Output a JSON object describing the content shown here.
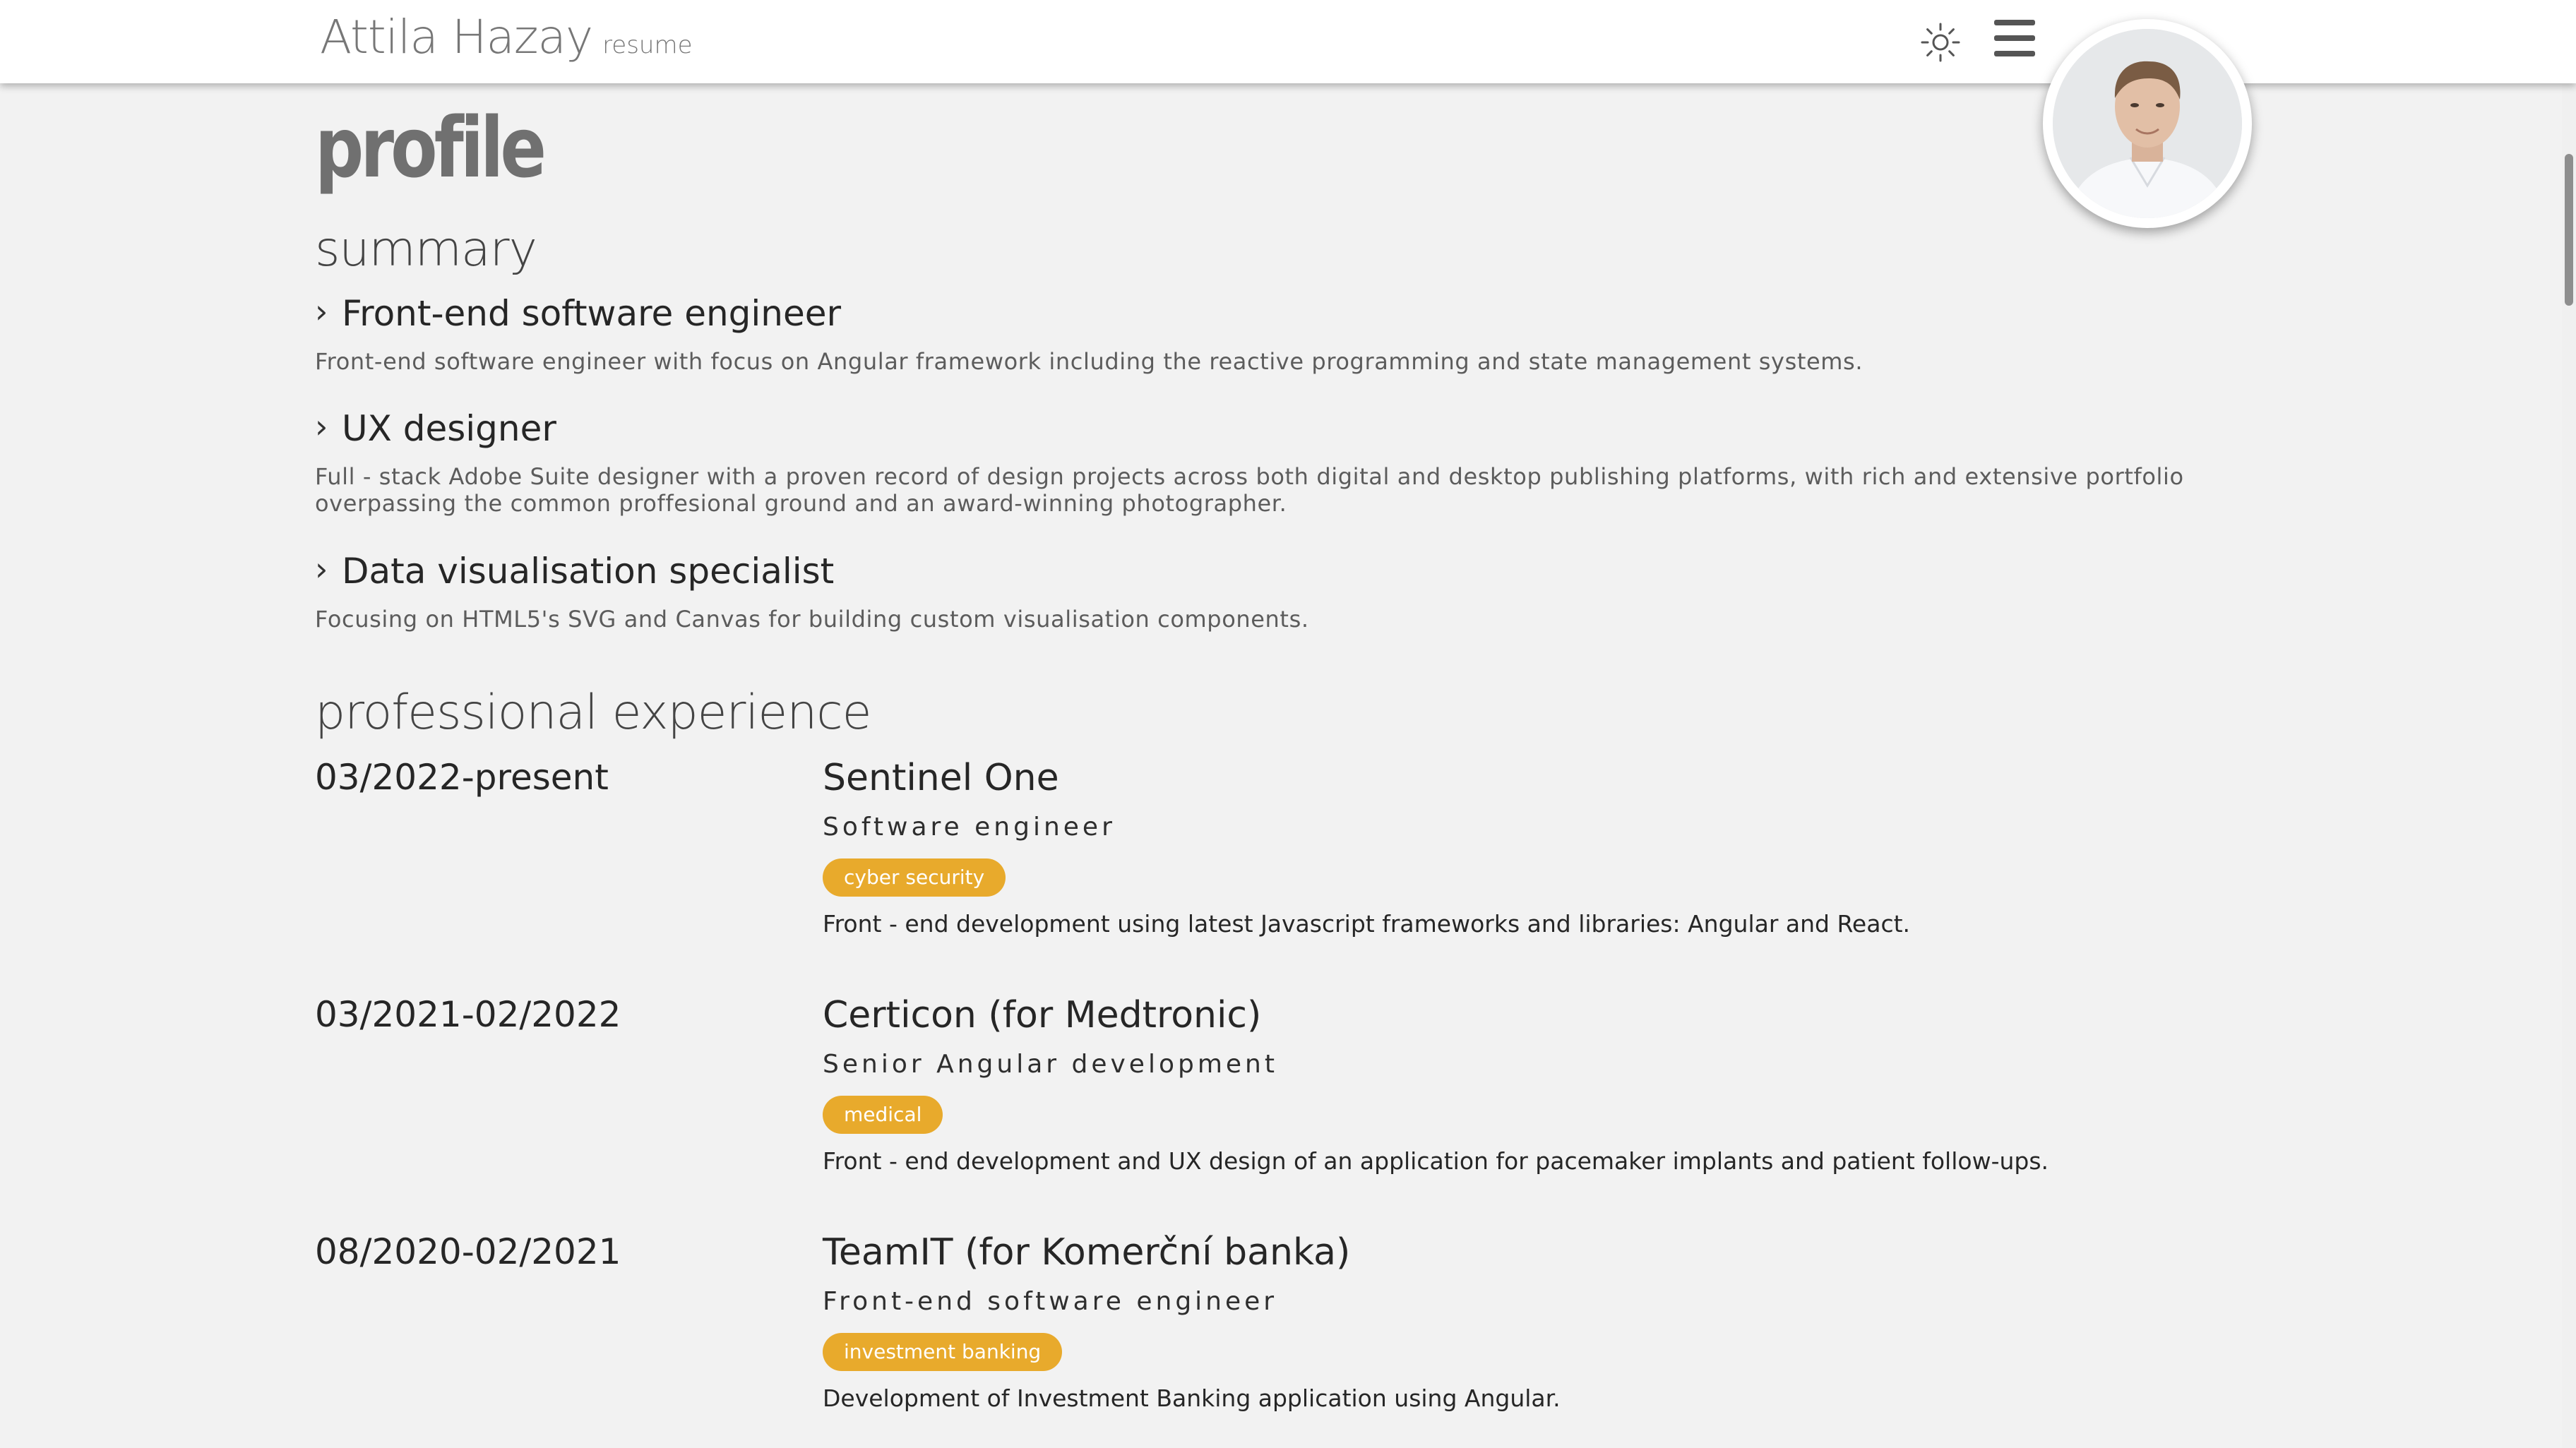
{
  "header": {
    "brand_name": "Attila Hazay",
    "brand_sub": "resume",
    "theme_icon": "sun-icon",
    "menu_icon": "hamburger-menu-icon",
    "avatar": "profile-photo"
  },
  "page": {
    "title": "profile"
  },
  "summary": {
    "title": "summary",
    "items": [
      {
        "heading": "Front-end software engineer",
        "text": "Front-end software engineer with focus on Angular framework including the reactive programming and state management systems."
      },
      {
        "heading": "UX designer",
        "text": "Full - stack Adobe Suite designer with a proven record of design projects across both digital and desktop publishing platforms, with rich and extensive portfolio overpassing the common proffesional ground and an award-winning photographer."
      },
      {
        "heading": "Data visualisation specialist",
        "text": "Focusing on HTML5's SVG and Canvas for building custom visualisation components."
      }
    ]
  },
  "experience": {
    "title": "professional experience",
    "jobs": [
      {
        "date": "03/2022-present",
        "company": "Sentinel One",
        "role": "Software engineer",
        "tag": "cyber security",
        "description": "Front - end development using latest Javascript frameworks and libraries: Angular and React."
      },
      {
        "date": "03/2021-02/2022",
        "company": "Certicon (for Medtronic)",
        "role": "Senior Angular development",
        "tag": "medical",
        "description": "Front - end development and UX design of an application for pacemaker implants and patient follow-ups."
      },
      {
        "date": "08/2020-02/2021",
        "company": "TeamIT (for Komerční banka)",
        "role": "Front-end software engineer",
        "tag": "investment banking",
        "description": "Development of Investment Banking application using Angular."
      }
    ]
  },
  "colors": {
    "tag_background": "#e8aa2c",
    "page_background": "#f2f2f2",
    "header_background": "#ffffff"
  }
}
